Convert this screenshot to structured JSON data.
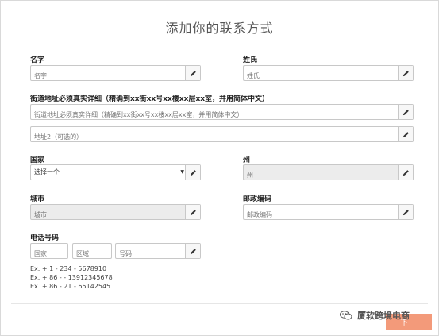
{
  "title": "添加你的联系方式",
  "first_name": {
    "label": "名字",
    "placeholder": "名字"
  },
  "last_name": {
    "label": "姓氏",
    "placeholder": "姓氏"
  },
  "street": {
    "label": "街道地址必须真实详细（精确到xx街xx号xx楼xx层xx室，并用简体中文）",
    "placeholder": "街道地址必须真实详细（精确到xx街xx号xx楼xx层xx室，并用简体中文）"
  },
  "address2": {
    "placeholder": "地址2（可选的）"
  },
  "country": {
    "label": "国家",
    "value": "选择一个"
  },
  "state": {
    "label": "州",
    "placeholder": "州"
  },
  "city": {
    "label": "城市",
    "placeholder": "城市"
  },
  "postal": {
    "label": "邮政编码",
    "placeholder": "邮政编码"
  },
  "phone": {
    "label": "电话号码",
    "country_placeholder": "国家",
    "area_placeholder": "区域",
    "number_placeholder": "号码",
    "examples": [
      "Ex. + 1 - 234 - 5678910",
      "Ex. + 86 - - 13912345678",
      "Ex. + 86 - 21 - 65142545"
    ]
  },
  "next_button": "下 一",
  "watermark": "厦软跨境电商",
  "icons": {
    "edit": "pencil-icon",
    "dropdown": "caret-down-icon",
    "watermark": "wechat-icon"
  },
  "colors": {
    "next_button": "#f39a7a",
    "disabled_field": "#ececec"
  }
}
